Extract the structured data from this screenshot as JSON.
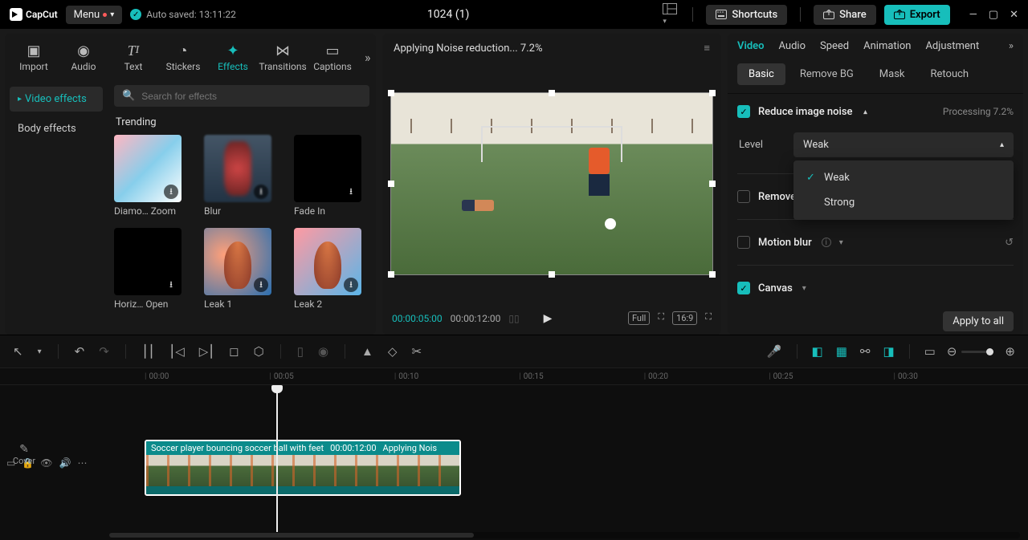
{
  "titlebar": {
    "app_name": "CapCut",
    "menu_label": "Menu",
    "autosave_label": "Auto saved: 13:11:22",
    "project_title": "1024 (1)",
    "shortcuts_label": "Shortcuts",
    "share_label": "Share",
    "export_label": "Export"
  },
  "media_tabs": [
    "Import",
    "Audio",
    "Text",
    "Stickers",
    "Effects",
    "Transitions",
    "Captions"
  ],
  "media_tab_active_index": 4,
  "left_sidebar": {
    "items": [
      "Video effects",
      "Body effects"
    ],
    "active_index": 0
  },
  "search_placeholder": "Search for effects",
  "effects_section": {
    "title": "Trending",
    "items": [
      {
        "name": "Diamo… Zoom"
      },
      {
        "name": "Blur"
      },
      {
        "name": "Fade In"
      },
      {
        "name": "Horiz… Open"
      },
      {
        "name": "Leak 1"
      },
      {
        "name": "Leak 2"
      }
    ]
  },
  "preview": {
    "status": "Applying Noise reduction... 7.2%",
    "current_time": "00:00:05:00",
    "duration": "00:00:12:00",
    "ratio_label": "16:9",
    "full_label": "Full"
  },
  "inspector": {
    "tabs": [
      "Video",
      "Audio",
      "Speed",
      "Animation",
      "Adjustment"
    ],
    "active_tab_index": 0,
    "sub_tabs": [
      "Basic",
      "Remove BG",
      "Mask",
      "Retouch"
    ],
    "sub_tab_active_index": 0,
    "reduce_noise": {
      "label": "Reduce image noise",
      "enabled": true,
      "processing_label": "Processing 7.2%",
      "level_label": "Level",
      "level_value": "Weak",
      "level_options": [
        "Weak",
        "Strong"
      ]
    },
    "remove_flicker_label": "Remove",
    "motion_blur_label": "Motion blur",
    "canvas_label": "Canvas",
    "apply_all_label": "Apply to all"
  },
  "timeline": {
    "ruler": [
      "00:00",
      "00:05",
      "00:10",
      "00:15",
      "00:20",
      "00:25",
      "00:30"
    ],
    "clip": {
      "title": "Soccer player bouncing soccer ball with feet",
      "duration": "00:00:12:00",
      "effect": "Applying Nois"
    },
    "cover_label": "Cover"
  }
}
